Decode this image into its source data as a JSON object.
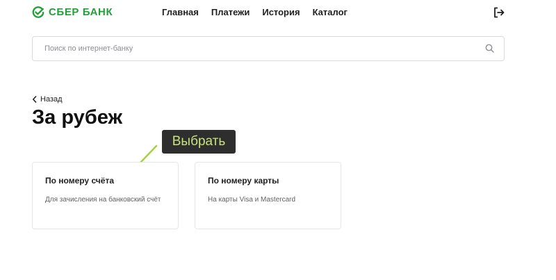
{
  "header": {
    "logo_text": "СБЕР БАНК",
    "brand_color": "#21A038",
    "nav": [
      {
        "label": "Главная"
      },
      {
        "label": "Платежи"
      },
      {
        "label": "История"
      },
      {
        "label": "Каталог"
      }
    ],
    "logout_icon": "logout-icon"
  },
  "search": {
    "placeholder": "Поиск по интернет-банку",
    "value": "",
    "icon": "search-icon"
  },
  "back": {
    "label": "Назад",
    "icon": "chevron-left-icon"
  },
  "page": {
    "title": "За рубеж"
  },
  "annotation": {
    "label": "Выбрать",
    "label_color": "#C7E37D",
    "arrow_color": "#A5CF3B"
  },
  "cards": [
    {
      "title": "По номеру счёта",
      "description": "Для зачисления на банковский счёт"
    },
    {
      "title": "По номеру карты",
      "description": "На карты Visa и Mastercard"
    }
  ]
}
